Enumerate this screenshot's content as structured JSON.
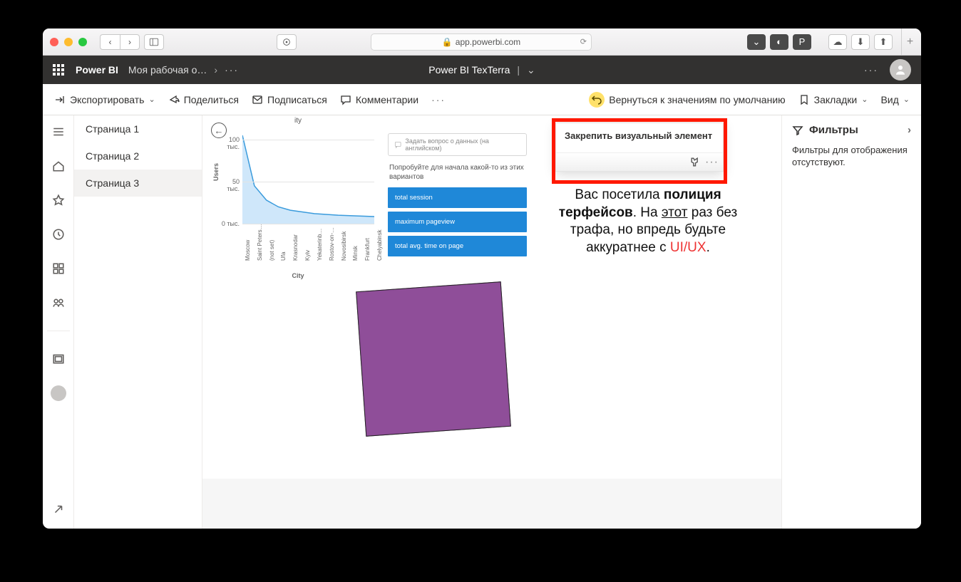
{
  "browser": {
    "address": "app.powerbi.com"
  },
  "app": {
    "title": "Power BI",
    "workspace": "Моя рабочая о…",
    "report": "Power BI TexTerra"
  },
  "cmd": {
    "export": "Экспортировать",
    "share": "Поделиться",
    "subscribe": "Подписаться",
    "comments": "Комментарии",
    "reset": "Вернуться к значениям по умолчанию",
    "bookmarks": "Закладки",
    "view": "Вид"
  },
  "pages": [
    "Страница 1",
    "Страница 2",
    "Страница 3"
  ],
  "active_page": 2,
  "qa": {
    "placeholder": "Задать вопрос о данных (на английском)",
    "hint": "Попробуйте для начала какой-то из этих вариантов",
    "suggestions": [
      "total session",
      "maximum pageview",
      "total avg. time on page"
    ]
  },
  "tooltip": {
    "title": "Закрепить визуальный элемент"
  },
  "joke": {
    "t1": "Вас посетила ",
    "b1": "полиция",
    "t2": "терфейсов",
    "t3": ". На ",
    "u1": "этот",
    "t4": " раз без",
    "t5": "трафа, но впредь будьте",
    "t6": "аккуратнее с ",
    "r1": "UI/UX",
    "t7": "."
  },
  "filters": {
    "title": "Фильтры",
    "empty": "Фильтры для отображения отсутствуют."
  },
  "chart_data": {
    "type": "area",
    "title_fragment": "ity",
    "xlabel": "City",
    "ylabel": "Users",
    "ylim": [
      0,
      110000
    ],
    "yticks": [
      {
        "v": 0,
        "label": "0 тыс."
      },
      {
        "v": 50000,
        "label": "50 тыс."
      },
      {
        "v": 100000,
        "label": "100 тыс."
      }
    ],
    "categories": [
      "Moscow",
      "Saint Peters…",
      "(not set)",
      "Ufa",
      "Krasnodar",
      "Kyiv",
      "Yekaterinb…",
      "Rostov-on-…",
      "Novosibirsk",
      "Minsk",
      "Frankfurt",
      "Chelyabinsk"
    ],
    "values": [
      105000,
      45000,
      28000,
      20000,
      16000,
      14000,
      12000,
      11000,
      10000,
      9500,
      9000,
      8500
    ]
  }
}
